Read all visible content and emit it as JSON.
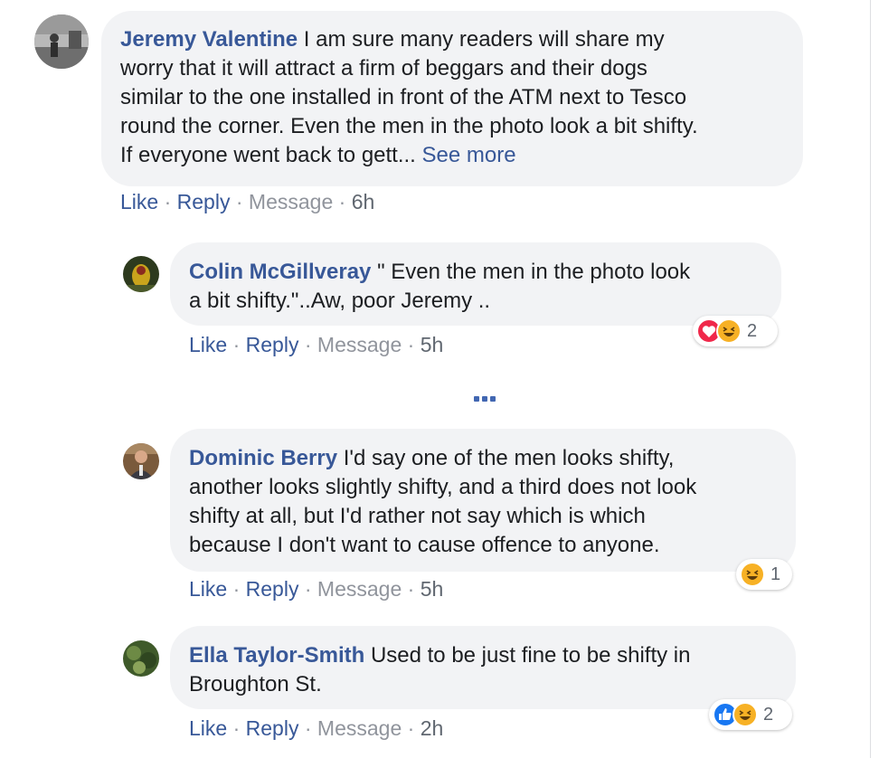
{
  "comment_main": {
    "author": "Jeremy Valentine",
    "lines": [
      "I am sure many readers will share my",
      "worry that it will attract a firm of beggars and their dogs",
      "similar to the one installed in front of the ATM next to Tesco",
      "round the corner. Even the men in the photo look a bit shifty.",
      "If everyone went back to gett..."
    ],
    "see_more": "See more",
    "like": "Like",
    "reply": "Reply",
    "message": "Message",
    "time": "6h",
    "sep": "·"
  },
  "reply_colin": {
    "author": "Colin McGillveray",
    "lines": [
      "\" Even the men in the photo look",
      "a bit shifty.\"..Aw, poor Jeremy .."
    ],
    "like": "Like",
    "reply": "Reply",
    "message": "Message",
    "time": "5h",
    "sep": "·",
    "reaction_count": "2",
    "reaction_icons": [
      "love-icon",
      "haha-icon"
    ]
  },
  "reply_dominic": {
    "author": "Dominic Berry",
    "lines": [
      "I'd say one of the men looks shifty,",
      "another looks slightly shifty, and a third does not look",
      "shifty at all, but I'd rather not say which is which",
      "because I don't want to cause offence to anyone."
    ],
    "like": "Like",
    "reply": "Reply",
    "message": "Message",
    "time": "5h",
    "sep": "·",
    "reaction_count": "1",
    "reaction_icons": [
      "haha-icon"
    ]
  },
  "reply_ella": {
    "author": "Ella Taylor-Smith",
    "lines": [
      "Used to be just fine to be shifty in",
      "Broughton St."
    ],
    "like": "Like",
    "reply": "Reply",
    "message": "Message",
    "time": "2h",
    "sep": "·",
    "reaction_count": "2",
    "reaction_icons": [
      "like-icon",
      "haha-icon"
    ]
  },
  "colors": {
    "link": "#385898",
    "bubble": "#f2f3f5",
    "muted": "#90949c",
    "love": "#f0284a",
    "haha": "#f7b125",
    "like": "#1877f2"
  }
}
